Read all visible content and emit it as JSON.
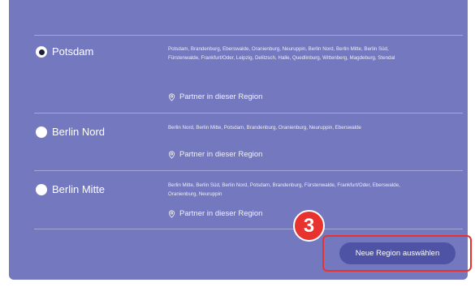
{
  "regions": [
    {
      "name": "Potsdam",
      "selected": true,
      "cities": "Potsdam, Brandenburg, Eberswalde, Oranienburg, Neuruppin, Berlin Nord, Berlin Mitte, Berlin Süd, Fürstenwalde, Frankfurt/Oder, Leipzig, Delitzsch, Halle, Quedlinburg, Wittenberg, Magdeburg, Stendal",
      "partner_label": "Partner in dieser Region"
    },
    {
      "name": "Berlin Nord",
      "selected": false,
      "cities": "Berlin Nord, Berlin Mitte, Potsdam, Brandenburg, Oranienburg, Neuruppin, Eberswalde",
      "partner_label": "Partner in dieser Region"
    },
    {
      "name": "Berlin Mitte",
      "selected": false,
      "cities": "Berlin Mitte, Berlin Süd, Berlin Nord, Potsdam, Brandenburg, Fürstenwalde, Frankfurt/Oder, Eberswalde, Oranienburg, Neuruppin",
      "partner_label": "Partner in dieser Region"
    }
  ],
  "step_badge": "3",
  "select_button_label": "Neue Region auswählen",
  "colors": {
    "panel_bg": "#7378bf",
    "button_bg": "#4f53a6",
    "highlight": "#e8322f"
  },
  "icons": {
    "partner": "location-pin-icon"
  }
}
